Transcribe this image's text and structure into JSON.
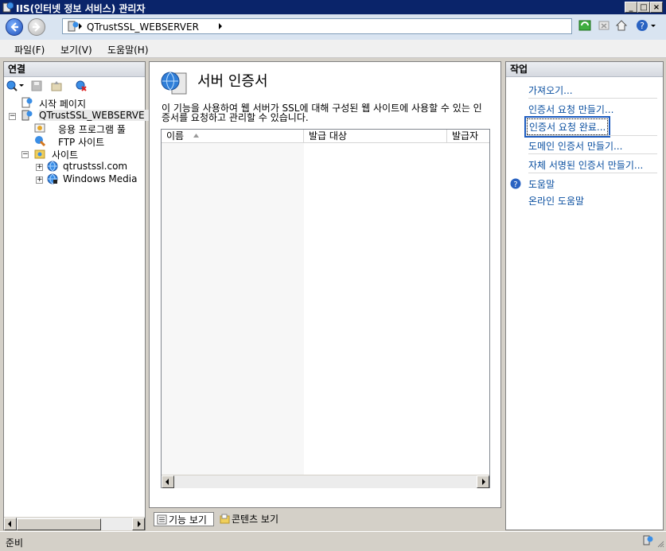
{
  "window": {
    "title": "IIS(인터넷 정보 서비스) 관리자",
    "minimize": "_",
    "maximize": "□",
    "close": "×"
  },
  "address": {
    "segments": [
      "QTrustSSL_WEBSERVER"
    ]
  },
  "menu": {
    "file": "파일(F)",
    "view": "보기(V)",
    "help": "도움말(H)"
  },
  "connections": {
    "header": "연결",
    "tree": [
      {
        "label": "시작 페이지",
        "icon": "start-page-icon"
      },
      {
        "label": "QTrustSSL_WEBSERVE",
        "icon": "server-icon"
      },
      {
        "label": "응용 프로그램 풀",
        "icon": "app-pool-icon"
      },
      {
        "label": "FTP 사이트",
        "icon": "ftp-icon"
      },
      {
        "label": "사이트",
        "icon": "folder-icon"
      },
      {
        "label": "qtrustssl.com",
        "icon": "globe-icon"
      },
      {
        "label": "Windows Media",
        "icon": "globe-icon"
      }
    ]
  },
  "content": {
    "title": "서버 인증서",
    "description": "이 기능을 사용하여 웹 서버가 SSL에 대해 구성된 웹 사이트에 사용할 수 있는 인증서를 요청하고 관리할 수 있습니다.",
    "columns": [
      "이름",
      "발급 대상",
      "발급자"
    ],
    "rows": []
  },
  "view_tabs": {
    "features": "기능 보기",
    "content": "콘텐츠 보기"
  },
  "actions": {
    "header": "작업",
    "items": [
      "가져오기...",
      "인증서 요청 만들기...",
      "인증서 요청 완료...",
      "도메인 인증서 만들기...",
      "자체 서명된 인증서 만들기..."
    ],
    "help": "도움말",
    "online_help": "온라인 도움말"
  },
  "status": {
    "text": "준비"
  }
}
